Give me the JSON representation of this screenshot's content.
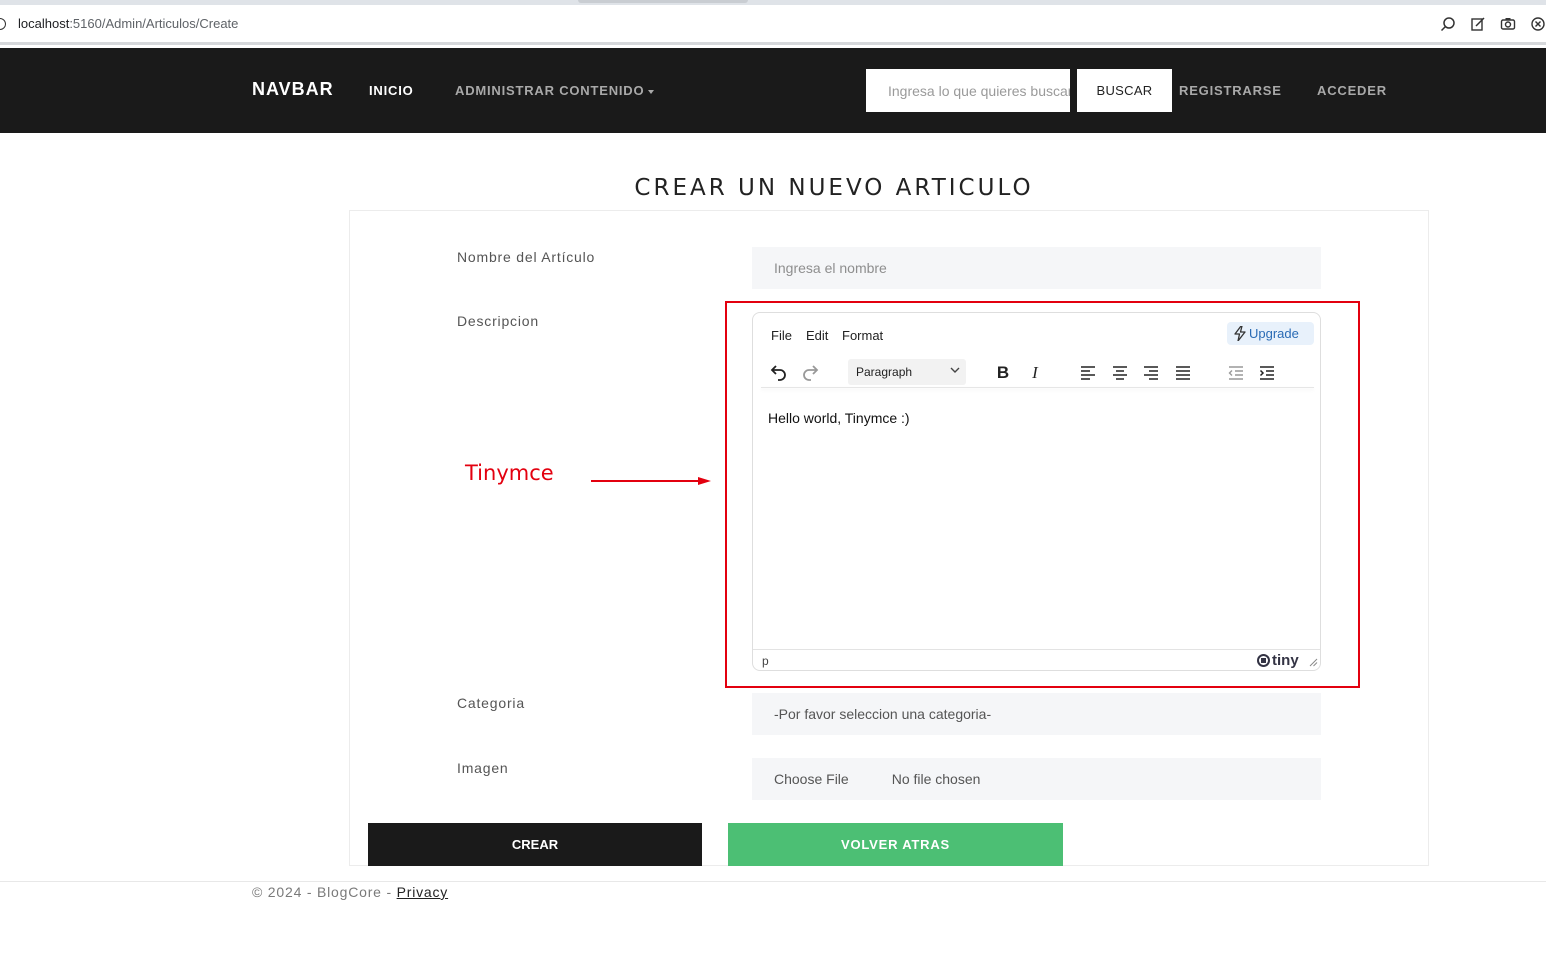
{
  "browser": {
    "url_host": "localhost",
    "url_path": ":5160/Admin/Articulos/Create"
  },
  "navbar": {
    "brand": "NAVBAR",
    "links": {
      "inicio": "INICIO",
      "admin": "ADMINISTRAR CONTENIDO",
      "registrarse": "REGISTRARSE",
      "acceder": "ACCEDER"
    },
    "search_placeholder": "Ingresa lo que quieres buscar",
    "search_button": "BUSCAR"
  },
  "page": {
    "title": "CREAR UN NUEVO ARTICULO"
  },
  "form": {
    "nombre_label": "Nombre del Artículo",
    "nombre_placeholder": "Ingresa el nombre",
    "descripcion_label": "Descripcion",
    "categoria_label": "Categoria",
    "categoria_selected": "-Por favor seleccion una categoria-",
    "imagen_label": "Imagen",
    "file_button": "Choose File",
    "file_status": "No file chosen"
  },
  "editor": {
    "menu": [
      "File",
      "Edit",
      "Format"
    ],
    "upgrade": "Upgrade",
    "block_format": "Paragraph",
    "content": "Hello world, Tinymce :)",
    "path": "p",
    "brand": "tiny"
  },
  "annotation": {
    "label": "Tinymce",
    "color": "#e3000f"
  },
  "buttons": {
    "crear": "CREAR",
    "volver": "VOLVER ATRAS"
  },
  "footer": {
    "text": "© 2024 - BlogCore - ",
    "privacy": "Privacy"
  },
  "colors": {
    "navbar_bg": "#1a1a1a",
    "volver_bg": "#4cbf74",
    "annotation_red": "#e3000f"
  }
}
